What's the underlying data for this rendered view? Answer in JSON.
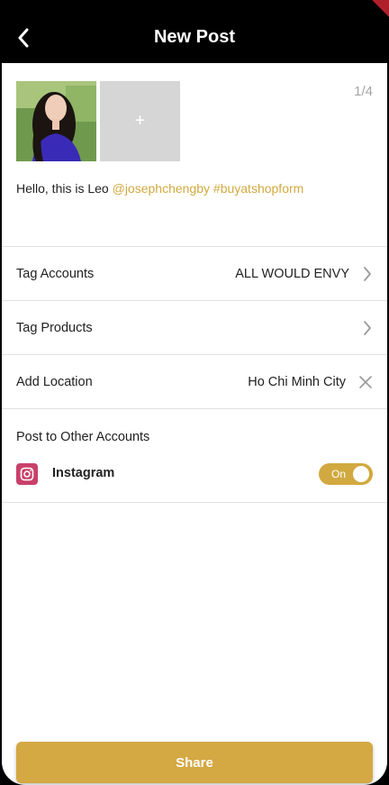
{
  "header": {
    "title": "New Post",
    "back_icon": "chevron-left-icon"
  },
  "media": {
    "counter": "1/4",
    "add_label": "+"
  },
  "caption": {
    "text": "Hello, this is Leo",
    "mention": "@josephchengby",
    "hashtag": "#buyatshopform"
  },
  "rows": {
    "tag_accounts": {
      "label": "Tag Accounts",
      "value": "ALL WOULD ENVY"
    },
    "tag_products": {
      "label": "Tag Products"
    },
    "add_location": {
      "label": "Add Location",
      "value": "Ho Chi Minh City"
    }
  },
  "other_accounts": {
    "title": "Post to Other Accounts",
    "instagram_label": "Instagram",
    "toggle_label": "On",
    "toggle_on": true
  },
  "share_label": "Share",
  "colors": {
    "accent": "#d2a940",
    "header_bg": "#000000",
    "placeholder_gray": "#d6d6d6",
    "instagram": "#c9416a"
  }
}
